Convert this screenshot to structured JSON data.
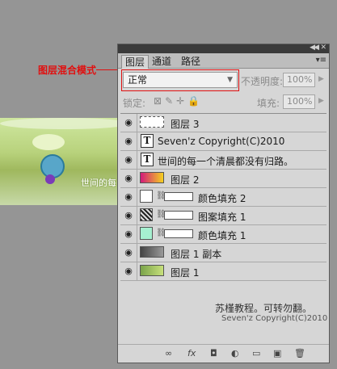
{
  "annotation": {
    "label": "图层混合模式"
  },
  "canvas": {
    "caption": "世间的每"
  },
  "panel": {
    "tabs": [
      {
        "label": "图层"
      },
      {
        "label": "通道"
      },
      {
        "label": "路径"
      }
    ],
    "blend_mode": {
      "value": "正常"
    },
    "opacity": {
      "label": "不透明度:",
      "value": "100%"
    },
    "lock": {
      "label": "锁定:"
    },
    "fill": {
      "label": "填充:",
      "value": "100%"
    },
    "layers": [
      {
        "name": "图层 3"
      },
      {
        "name": "Seven'z Copyright(C)2010"
      },
      {
        "name": "世间的每一个清晨都没有归路。"
      },
      {
        "name": "图层 2"
      },
      {
        "name": "颜色填充 2"
      },
      {
        "name": "图案填充 1"
      },
      {
        "name": "颜色填充 1"
      },
      {
        "name": "图层 1 副本"
      },
      {
        "name": "图层 1"
      }
    ],
    "text1": "苏槿教程。可转勿翻。",
    "text2": "Seven'z Copyright(C)2010",
    "colors": {
      "layer3_thumb": "#ffffff",
      "layer2_gradient_start": "#d21a7a",
      "layer2_gradient_end": "#f5d020",
      "fill1_color": "#a6f0d0",
      "fill2_color": "#ffffff"
    }
  }
}
